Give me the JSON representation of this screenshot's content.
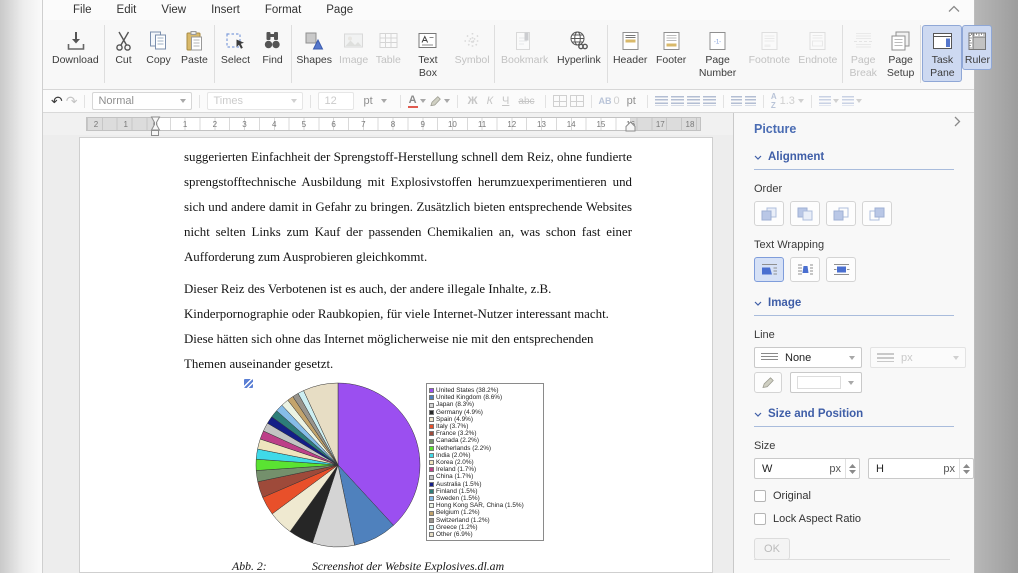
{
  "menu": {
    "items": [
      "File",
      "Edit",
      "View",
      "Insert",
      "Format",
      "Page"
    ]
  },
  "toolbar": {
    "groups": [
      [
        {
          "label": "Download",
          "icon": "download",
          "state": "normal"
        }
      ],
      [
        {
          "label": "Cut",
          "icon": "cut",
          "state": "normal"
        },
        {
          "label": "Copy",
          "icon": "copy",
          "state": "normal"
        },
        {
          "label": "Paste",
          "icon": "paste",
          "state": "normal"
        }
      ],
      [
        {
          "label": "Select",
          "icon": "select",
          "state": "normal"
        },
        {
          "label": "Find",
          "icon": "find",
          "state": "normal"
        }
      ],
      [
        {
          "label": "Shapes",
          "icon": "shapes",
          "state": "normal"
        },
        {
          "label": "Image",
          "icon": "image",
          "state": "disabled"
        },
        {
          "label": "Table",
          "icon": "table",
          "state": "disabled"
        },
        {
          "label": "Text Box",
          "icon": "textbox",
          "state": "normal"
        },
        {
          "label": "Symbol",
          "icon": "symbol",
          "state": "disabled"
        }
      ],
      [
        {
          "label": "Bookmark",
          "icon": "bookmark",
          "state": "disabled"
        },
        {
          "label": "Hyperlink",
          "icon": "hyperlink",
          "state": "normal"
        }
      ],
      [
        {
          "label": "Header",
          "icon": "header",
          "state": "normal"
        },
        {
          "label": "Footer",
          "icon": "footer",
          "state": "normal"
        },
        {
          "label": "Page Number",
          "icon": "pagenumber",
          "state": "normal"
        },
        {
          "label": "Footnote",
          "icon": "footnote",
          "state": "disabled"
        },
        {
          "label": "Endnote",
          "icon": "endnote",
          "state": "disabled"
        }
      ],
      [
        {
          "label": "Page Break",
          "icon": "pagebreak",
          "state": "disabled"
        },
        {
          "label": "Page Setup",
          "icon": "pagesetup",
          "state": "normal"
        }
      ],
      [
        {
          "label": "Task Pane",
          "icon": "taskpane",
          "state": "active"
        },
        {
          "label": "Ruler",
          "icon": "rulericon",
          "state": "active"
        }
      ]
    ]
  },
  "format_bar": {
    "undo": "↶",
    "redo": "↷",
    "paragraph_style": "Normal",
    "font_name": "Times",
    "font_size": "12",
    "size_unit": "pt",
    "color_letter": "A",
    "bold_label": "Ж",
    "italic_label": "К",
    "underline_label": "Ч",
    "strikethrough_label": "abc",
    "spacing_letters": "AB",
    "spacing_value": "0",
    "spacing_unit": "pt",
    "line_spacing_value": "1.3"
  },
  "ruler": {
    "numbers": [
      "2",
      "1",
      "0",
      "1",
      "2",
      "3",
      "4",
      "5",
      "6",
      "7",
      "8",
      "9",
      "10",
      "11",
      "12",
      "13",
      "14",
      "15",
      "16",
      "17",
      "18"
    ]
  },
  "document": {
    "paragraph1": "suggerierten Einfachheit der Sprengstoff-Herstellung schnell dem Reiz, ohne fundierte sprengstofftechnische Ausbildung mit Explosivstoffen herumzuexperimentieren und sich und andere damit in Gefahr zu bringen. Zusätzlich bieten entsprechende Websites nicht selten Links zum Kauf der passenden Chemikalien an, was schon fast einer Aufforderung zum Ausprobieren gleichkommt.",
    "paragraph2": "Dieser Reiz des Verbotenen ist es auch, der andere illegale Inhalte, z.B. Kinderpornographie oder Raubkopien, für viele Internet-Nutzer interessant macht. Diese hätten sich ohne das Internet möglicherweise nie mit den entsprechenden Themen auseinander gesetzt.",
    "caption_label": "Abb. 2:",
    "caption_text": "Screenshot der Website Explosives.dl.am"
  },
  "chart_data": {
    "type": "pie",
    "labels": [
      "United States",
      "United Kingdom",
      "Japan",
      "Germany",
      "Spain",
      "Italy",
      "France",
      "Canada",
      "Netherlands",
      "India",
      "Korea",
      "Ireland",
      "China",
      "Australia",
      "Finland",
      "Sweden",
      "Hong Kong SAR, China",
      "Belgium",
      "Switzerland",
      "Greece",
      "Other"
    ],
    "values": [
      38.2,
      8.6,
      8.3,
      4.9,
      4.9,
      3.7,
      3.2,
      2.2,
      2.2,
      2.0,
      2.0,
      1.7,
      1.7,
      1.5,
      1.5,
      1.5,
      1.5,
      1.2,
      1.2,
      1.2,
      6.9
    ],
    "colors": [
      "#9b4ff0",
      "#4f81bd",
      "#d4d4d4",
      "#262626",
      "#efe9d0",
      "#e8502a",
      "#9e4a3a",
      "#74906c",
      "#5ae332",
      "#3fd9e8",
      "#efe4bd",
      "#bd3f88",
      "#c3c3c3",
      "#141e87",
      "#2d7d79",
      "#85bce8",
      "#ebf3e3",
      "#c3a46c",
      "#98948c",
      "#cdeff2",
      "#e7ddc4"
    ],
    "legend_position": "right",
    "start_angle_deg": -90,
    "direction": "clockwise"
  },
  "sidebar": {
    "title": "Picture",
    "alignment": {
      "label": "Alignment",
      "order_label": "Order",
      "wrap_label": "Text Wrapping"
    },
    "image": {
      "label": "Image",
      "line_label": "Line",
      "line_style_value": "None",
      "line_width_unit": "px"
    },
    "size_position": {
      "label": "Size and Position",
      "size_label": "Size",
      "width_label": "W",
      "height_label": "H",
      "width_unit": "px",
      "height_unit": "px",
      "original_label": "Original",
      "lock_label": "Lock Aspect Ratio",
      "ok_label": "OK"
    }
  }
}
